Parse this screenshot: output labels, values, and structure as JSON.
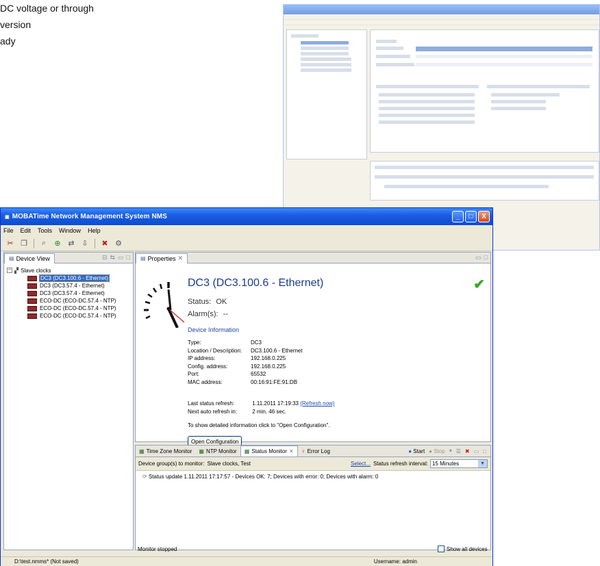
{
  "doc_text": {
    "lines": [
      "DC voltage or through",
      "version",
      "ady"
    ]
  },
  "window": {
    "title": "MOBATime Network Management System NMS",
    "minimize": "_",
    "maximize": "□",
    "close": "X"
  },
  "menu": [
    "File",
    "Edit",
    "Tools",
    "Window",
    "Help"
  ],
  "device_view": {
    "tab_label": "Device View",
    "root": "Slave clocks",
    "items": [
      {
        "label": "DC3 (DC3.100.6 - Ethernet)",
        "selected": true
      },
      {
        "label": "DC3 (DC3.57.4 - Ethernet)"
      },
      {
        "label": "DC3 (DC3.57.4 - Ethernet)"
      },
      {
        "label": "ECO-DC (ECO-DC.57.4 - NTP)"
      },
      {
        "label": "ECO-DC (ECO-DC.57.4 - NTP)"
      },
      {
        "label": "ECO-DC (ECO-DC.57.4 - NTP)"
      }
    ]
  },
  "properties": {
    "tab_label": "Properties",
    "device_title": "DC3 (DC3.100.6 - Ethernet)",
    "status_label": "Status:",
    "status_value": "OK",
    "alarm_label": "Alarm(s):",
    "alarm_value": "--",
    "device_info_heading": "Device Information",
    "info": [
      {
        "key": "Type:",
        "value": "DC3"
      },
      {
        "key": "Location / Description:",
        "value": "DC3.100.6 - Ethernet"
      },
      {
        "key": "IP address:",
        "value": "192.168.0.225"
      },
      {
        "key": "Config. address:",
        "value": "192.168.0.225"
      },
      {
        "key": "Port:",
        "value": "65532"
      },
      {
        "key": "MAC address:",
        "value": "00:16:91:FE:91:DB"
      }
    ],
    "last_refresh_label": "Last status refresh:",
    "last_refresh_value": "1.11.2011 17:19:33",
    "refresh_now": "(Refresh now)",
    "next_refresh_label": "Next auto refresh in:",
    "next_refresh_value": "2 min. 46 sec.",
    "hint": "To show detailed information click to \"Open Configuration\".",
    "open_config": "Open Configuration"
  },
  "monitor": {
    "tabs": [
      {
        "label": "Time Zone Monitor"
      },
      {
        "label": "NTP Monitor"
      },
      {
        "label": "Status Monitor",
        "active": true
      },
      {
        "label": "Error Log"
      }
    ],
    "start": "Start",
    "stop": "Stop",
    "groups_label": "Device group(s) to monitor:",
    "groups_value": "Slave clocks, Test",
    "select": "Select...",
    "interval_label": "Status refresh interval:",
    "interval_value": "15 Minutes",
    "log_line": "Status update 1.11.2011 17:17:57 - Devices OK: 7; Devices with error: 0; Devices with alarm: 0",
    "stopped": "Monitor stopped",
    "show_all": "Show all devices"
  },
  "statusbar": {
    "path": "D:\\test.nmms* (Not saved)",
    "user": "Username: admin"
  }
}
